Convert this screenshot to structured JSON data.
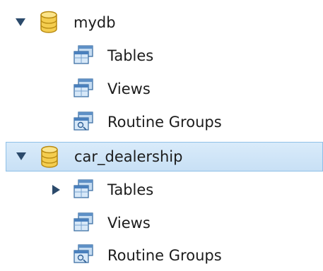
{
  "tree": {
    "databases": [
      {
        "name": "mydb",
        "expanded": true,
        "selected": false,
        "icon": "database-icon",
        "children": [
          {
            "label": "Tables",
            "icon": "tables-icon",
            "expandable": false
          },
          {
            "label": "Views",
            "icon": "views-icon",
            "expandable": false
          },
          {
            "label": "Routine Groups",
            "icon": "routine-groups-icon",
            "expandable": false
          }
        ]
      },
      {
        "name": "car_dealership",
        "expanded": true,
        "selected": true,
        "icon": "database-icon",
        "children": [
          {
            "label": "Tables",
            "icon": "tables-icon",
            "expandable": true,
            "expanded": false
          },
          {
            "label": "Views",
            "icon": "views-icon",
            "expandable": false
          },
          {
            "label": "Routine Groups",
            "icon": "routine-groups-icon",
            "expandable": false
          }
        ]
      }
    ]
  },
  "colors": {
    "selection_background": "#d2e6f8",
    "selection_border": "#8fc0e8",
    "arrow": "#2b4a6b",
    "database_icon": "#f0c23a"
  }
}
